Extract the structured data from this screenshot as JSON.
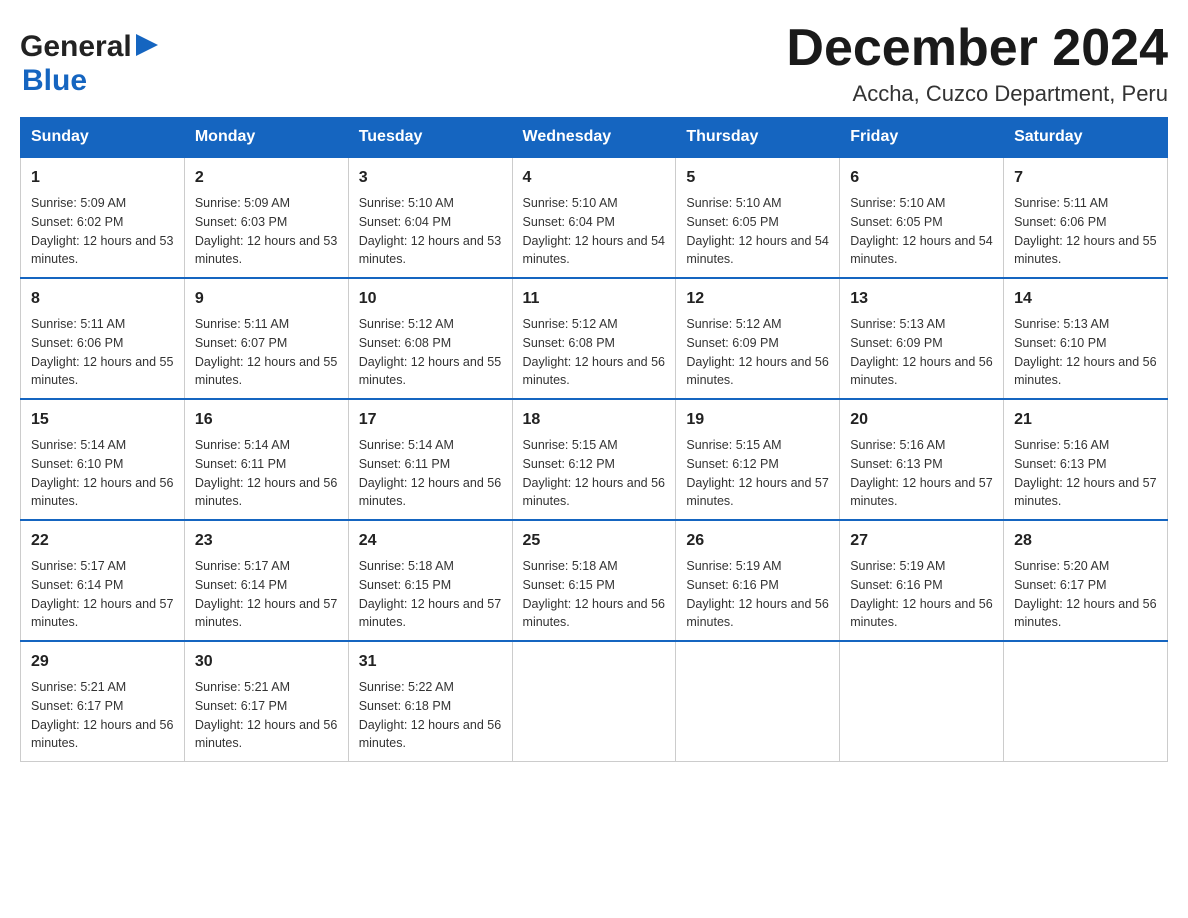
{
  "header": {
    "logo_general": "General",
    "logo_blue": "Blue",
    "title": "December 2024",
    "subtitle": "Accha, Cuzco Department, Peru"
  },
  "days_of_week": [
    "Sunday",
    "Monday",
    "Tuesday",
    "Wednesday",
    "Thursday",
    "Friday",
    "Saturday"
  ],
  "weeks": [
    [
      {
        "day": "1",
        "sunrise": "5:09 AM",
        "sunset": "6:02 PM",
        "daylight": "12 hours and 53 minutes."
      },
      {
        "day": "2",
        "sunrise": "5:09 AM",
        "sunset": "6:03 PM",
        "daylight": "12 hours and 53 minutes."
      },
      {
        "day": "3",
        "sunrise": "5:10 AM",
        "sunset": "6:04 PM",
        "daylight": "12 hours and 53 minutes."
      },
      {
        "day": "4",
        "sunrise": "5:10 AM",
        "sunset": "6:04 PM",
        "daylight": "12 hours and 54 minutes."
      },
      {
        "day": "5",
        "sunrise": "5:10 AM",
        "sunset": "6:05 PM",
        "daylight": "12 hours and 54 minutes."
      },
      {
        "day": "6",
        "sunrise": "5:10 AM",
        "sunset": "6:05 PM",
        "daylight": "12 hours and 54 minutes."
      },
      {
        "day": "7",
        "sunrise": "5:11 AM",
        "sunset": "6:06 PM",
        "daylight": "12 hours and 55 minutes."
      }
    ],
    [
      {
        "day": "8",
        "sunrise": "5:11 AM",
        "sunset": "6:06 PM",
        "daylight": "12 hours and 55 minutes."
      },
      {
        "day": "9",
        "sunrise": "5:11 AM",
        "sunset": "6:07 PM",
        "daylight": "12 hours and 55 minutes."
      },
      {
        "day": "10",
        "sunrise": "5:12 AM",
        "sunset": "6:08 PM",
        "daylight": "12 hours and 55 minutes."
      },
      {
        "day": "11",
        "sunrise": "5:12 AM",
        "sunset": "6:08 PM",
        "daylight": "12 hours and 56 minutes."
      },
      {
        "day": "12",
        "sunrise": "5:12 AM",
        "sunset": "6:09 PM",
        "daylight": "12 hours and 56 minutes."
      },
      {
        "day": "13",
        "sunrise": "5:13 AM",
        "sunset": "6:09 PM",
        "daylight": "12 hours and 56 minutes."
      },
      {
        "day": "14",
        "sunrise": "5:13 AM",
        "sunset": "6:10 PM",
        "daylight": "12 hours and 56 minutes."
      }
    ],
    [
      {
        "day": "15",
        "sunrise": "5:14 AM",
        "sunset": "6:10 PM",
        "daylight": "12 hours and 56 minutes."
      },
      {
        "day": "16",
        "sunrise": "5:14 AM",
        "sunset": "6:11 PM",
        "daylight": "12 hours and 56 minutes."
      },
      {
        "day": "17",
        "sunrise": "5:14 AM",
        "sunset": "6:11 PM",
        "daylight": "12 hours and 56 minutes."
      },
      {
        "day": "18",
        "sunrise": "5:15 AM",
        "sunset": "6:12 PM",
        "daylight": "12 hours and 56 minutes."
      },
      {
        "day": "19",
        "sunrise": "5:15 AM",
        "sunset": "6:12 PM",
        "daylight": "12 hours and 57 minutes."
      },
      {
        "day": "20",
        "sunrise": "5:16 AM",
        "sunset": "6:13 PM",
        "daylight": "12 hours and 57 minutes."
      },
      {
        "day": "21",
        "sunrise": "5:16 AM",
        "sunset": "6:13 PM",
        "daylight": "12 hours and 57 minutes."
      }
    ],
    [
      {
        "day": "22",
        "sunrise": "5:17 AM",
        "sunset": "6:14 PM",
        "daylight": "12 hours and 57 minutes."
      },
      {
        "day": "23",
        "sunrise": "5:17 AM",
        "sunset": "6:14 PM",
        "daylight": "12 hours and 57 minutes."
      },
      {
        "day": "24",
        "sunrise": "5:18 AM",
        "sunset": "6:15 PM",
        "daylight": "12 hours and 57 minutes."
      },
      {
        "day": "25",
        "sunrise": "5:18 AM",
        "sunset": "6:15 PM",
        "daylight": "12 hours and 56 minutes."
      },
      {
        "day": "26",
        "sunrise": "5:19 AM",
        "sunset": "6:16 PM",
        "daylight": "12 hours and 56 minutes."
      },
      {
        "day": "27",
        "sunrise": "5:19 AM",
        "sunset": "6:16 PM",
        "daylight": "12 hours and 56 minutes."
      },
      {
        "day": "28",
        "sunrise": "5:20 AM",
        "sunset": "6:17 PM",
        "daylight": "12 hours and 56 minutes."
      }
    ],
    [
      {
        "day": "29",
        "sunrise": "5:21 AM",
        "sunset": "6:17 PM",
        "daylight": "12 hours and 56 minutes."
      },
      {
        "day": "30",
        "sunrise": "5:21 AM",
        "sunset": "6:17 PM",
        "daylight": "12 hours and 56 minutes."
      },
      {
        "day": "31",
        "sunrise": "5:22 AM",
        "sunset": "6:18 PM",
        "daylight": "12 hours and 56 minutes."
      },
      null,
      null,
      null,
      null
    ]
  ]
}
